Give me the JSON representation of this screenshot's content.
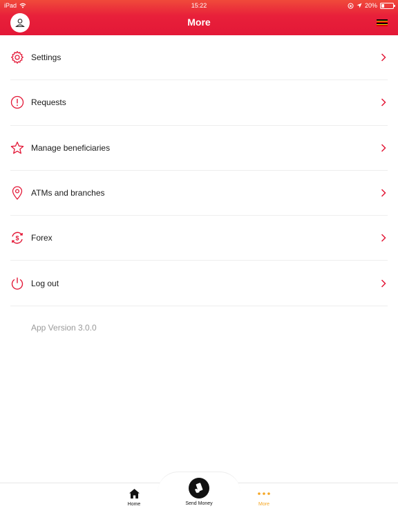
{
  "status_bar": {
    "device": "iPad",
    "time": "15:22",
    "battery_percent": "20%"
  },
  "header": {
    "title": "More",
    "flag": "uganda-flag"
  },
  "menu": [
    {
      "label": "Settings",
      "icon": "gear-icon"
    },
    {
      "label": "Requests",
      "icon": "exclamation-circle-icon"
    },
    {
      "label": "Manage beneficiaries",
      "icon": "star-icon"
    },
    {
      "label": "ATMs and branches",
      "icon": "location-pin-icon"
    },
    {
      "label": "Forex",
      "icon": "currency-exchange-icon"
    },
    {
      "label": "Log out",
      "icon": "power-icon"
    }
  ],
  "app_version": "App Version 3.0.0",
  "tabbar": {
    "home": "Home",
    "send_money": "Send Money",
    "more": "More",
    "active": "more"
  },
  "colors": {
    "brand_red": "#e31837",
    "active_tab": "#f5a623",
    "version_text": "#9a9a9a"
  }
}
